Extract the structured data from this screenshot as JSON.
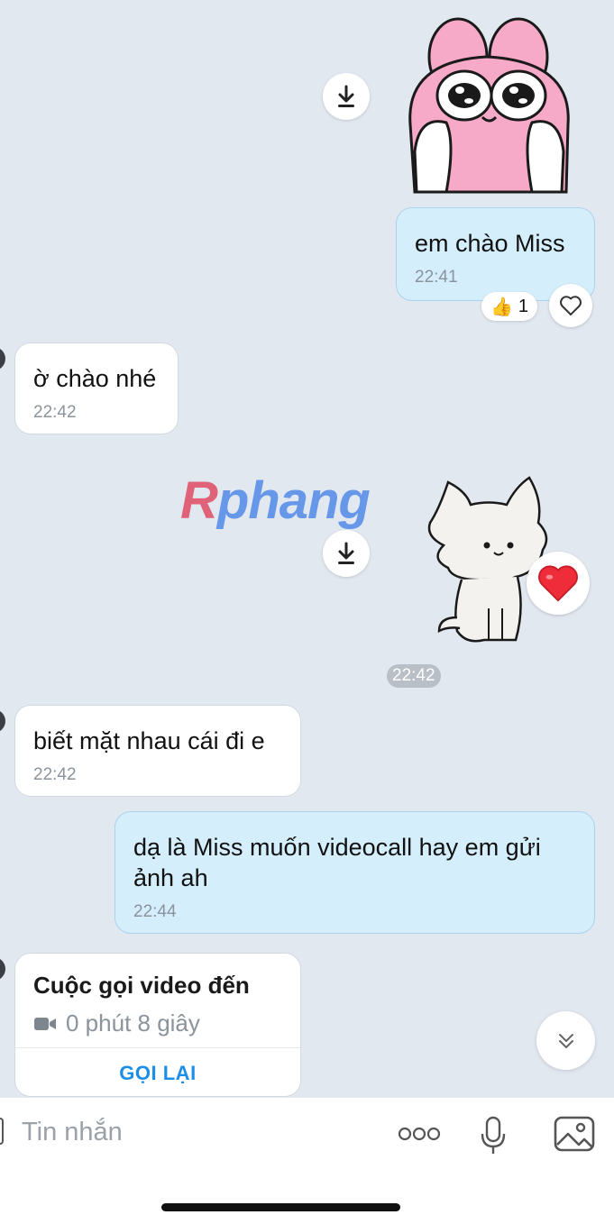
{
  "messages": [
    {
      "direction": "out",
      "type": "sticker",
      "sticker": "pink-bunny-sticker"
    },
    {
      "direction": "out",
      "type": "text",
      "text": "em chào Miss",
      "time": "22:41",
      "reaction": {
        "emoji": "👍",
        "count": "1"
      }
    },
    {
      "direction": "in",
      "type": "text",
      "text": "ờ chào nhé",
      "time": "22:42"
    },
    {
      "direction": "out",
      "type": "sticker",
      "sticker": "white-cat-sticker",
      "reaction": {
        "emoji": "❤️"
      }
    },
    {
      "type": "time-pill",
      "time": "22:42"
    },
    {
      "direction": "in",
      "type": "text",
      "text": "biết mặt nhau cái đi e",
      "time": "22:42"
    },
    {
      "direction": "out",
      "type": "text",
      "text": "dạ là Miss muốn videocall hay em gửi ảnh ah",
      "time": "22:44"
    }
  ],
  "call_card": {
    "title": "Cuộc gọi video đến",
    "duration": "0 phút 8 giây",
    "action": "GỌI LẠI"
  },
  "watermark": {
    "r": "R",
    "rest": "phang"
  },
  "composer": {
    "placeholder": "Tin nhắn"
  },
  "colors": {
    "background": "#e2e8f0",
    "outgoing_bubble": "#d5eefc",
    "incoming_bubble": "#ffffff",
    "accent": "#1d8ee8"
  },
  "icons": [
    "download-icon",
    "heart-outline-icon",
    "heart-icon",
    "chevrons-down-icon",
    "video-camera-icon",
    "more-dots-icon",
    "microphone-icon",
    "image-icon"
  ]
}
